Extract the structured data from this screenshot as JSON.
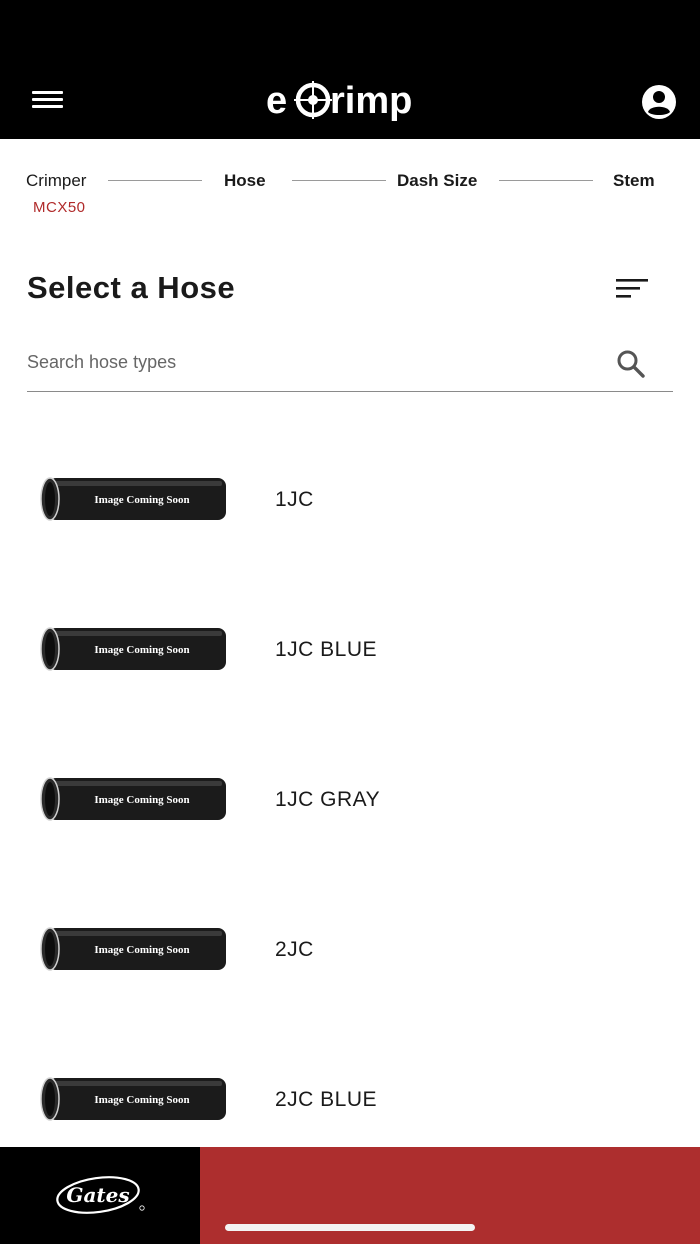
{
  "header": {
    "logo_text": "eCrimp",
    "menu_icon": "hamburger-menu-icon",
    "account_icon": "account-circle-icon"
  },
  "stepper": {
    "steps": [
      {
        "label": "Crimper",
        "sub": "MCX50",
        "active": false
      },
      {
        "label": "Hose",
        "active": true
      },
      {
        "label": "Dash Size",
        "active": true
      },
      {
        "label": "Stem",
        "active": true
      }
    ]
  },
  "main": {
    "title": "Select a Hose",
    "sort_icon": "sort-icon",
    "search": {
      "placeholder": "Search hose types",
      "value": "",
      "icon": "search-icon"
    }
  },
  "hoses": [
    {
      "name": "1JC",
      "image_text": "Image Coming Soon"
    },
    {
      "name": "1JC BLUE",
      "image_text": "Image Coming Soon"
    },
    {
      "name": "1JC GRAY",
      "image_text": "Image Coming Soon"
    },
    {
      "name": "2JC",
      "image_text": "Image Coming Soon"
    },
    {
      "name": "2JC BLUE",
      "image_text": "Image Coming Soon"
    }
  ],
  "footer": {
    "brand": "Gates",
    "colors": {
      "left": "#000000",
      "right": "#ad2e2e"
    }
  },
  "colors": {
    "accent": "#b02a2a",
    "header_bg": "#000000"
  }
}
